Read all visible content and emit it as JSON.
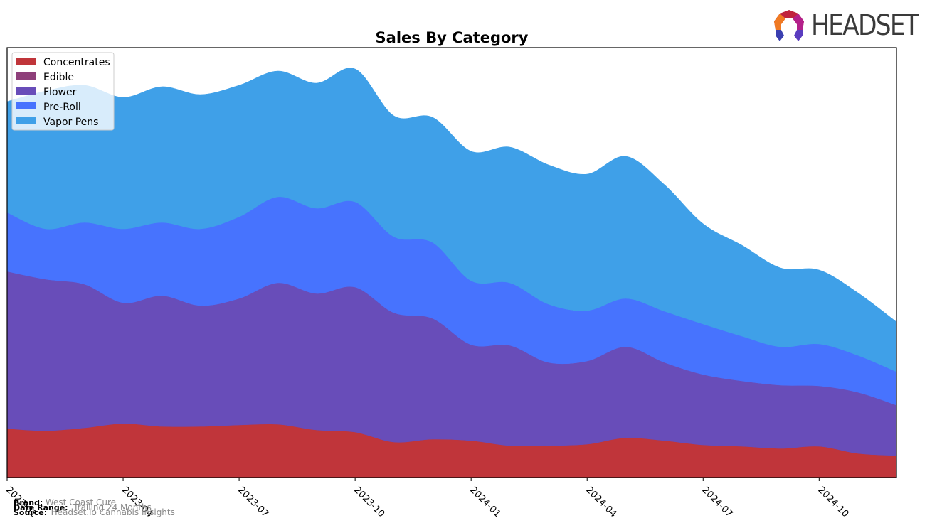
{
  "logo": {
    "text": "HEADSET"
  },
  "footer": {
    "brand_label": "Brand:",
    "brand_value": "West Coast Cure",
    "date_range_label": "Date Range:",
    "date_range_value": "Trailing 24 Months",
    "source_label": "Source:",
    "source_value": "Headset.io Cannabis Insights"
  },
  "chart_data": {
    "type": "area",
    "stacked": true,
    "title": "Sales By Category",
    "xlabel": "",
    "ylabel": "",
    "y_axis_visible": false,
    "value_units": "relative (no y-axis labels shown; values estimated from layer thickness)",
    "ylim": [
      0,
      605
    ],
    "grid": false,
    "legend_position": "top-left",
    "x": [
      "2023-01",
      "2023-02",
      "2023-03",
      "2023-04",
      "2023-05",
      "2023-06",
      "2023-07",
      "2023-08",
      "2023-09",
      "2023-10",
      "2023-11",
      "2023-12",
      "2024-01",
      "2024-02",
      "2024-03",
      "2024-04",
      "2024-05",
      "2024-06",
      "2024-07",
      "2024-08",
      "2024-09",
      "2024-10",
      "2024-11",
      "2024-12"
    ],
    "x_ticks": [
      "2023-01",
      "2023-04",
      "2023-07",
      "2023-10",
      "2024-01",
      "2024-04",
      "2024-07",
      "2024-10"
    ],
    "series": [
      {
        "name": "Concentrates",
        "color": "#c0353a",
        "values": [
          69,
          66,
          70,
          76,
          72,
          72,
          74,
          75,
          67,
          64,
          50,
          54,
          52,
          45,
          45,
          47,
          56,
          52,
          46,
          44,
          41,
          44,
          34,
          31
        ]
      },
      {
        "name": "Edible",
        "color": "#8e3f7a",
        "values": [
          0,
          0,
          0,
          0,
          0,
          0,
          0,
          0,
          0,
          0,
          0,
          0,
          0,
          0,
          0,
          0,
          0,
          0,
          0,
          0,
          0,
          0,
          0,
          0
        ]
      },
      {
        "name": "Flower",
        "color": "#684db9",
        "values": [
          221,
          213,
          202,
          170,
          184,
          170,
          178,
          199,
          192,
          204,
          182,
          170,
          135,
          141,
          117,
          117,
          128,
          110,
          99,
          92,
          89,
          85,
          86,
          71
        ]
      },
      {
        "name": "Pre-Roll",
        "color": "#4773fe",
        "values": [
          83,
          71,
          87,
          104,
          103,
          108,
          115,
          121,
          120,
          120,
          107,
          107,
          90,
          88,
          82,
          71,
          68,
          72,
          71,
          63,
          54,
          59,
          52,
          47
        ]
      },
      {
        "name": "Vapor Pens",
        "color": "#3fa0e8",
        "values": [
          156,
          194,
          193,
          185,
          191,
          189,
          185,
          177,
          176,
          187,
          170,
          176,
          182,
          191,
          196,
          192,
          200,
          178,
          141,
          128,
          111,
          104,
          88,
          70
        ]
      }
    ]
  }
}
